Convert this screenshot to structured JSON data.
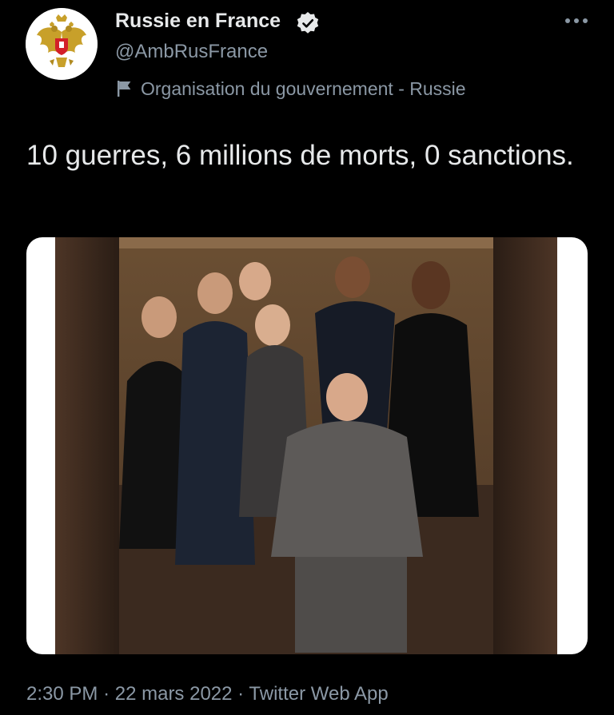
{
  "account": {
    "display_name": "Russie en France",
    "handle": "@AmbRusFrance",
    "org_label": "Organisation du gouvernement - Russie",
    "avatar_icon": "russian-coat-of-arms-icon",
    "verified_icon": "verified-badge-icon"
  },
  "tweet": {
    "text": "10 guerres, 6 millions de morts, 0 sanctions."
  },
  "meta": {
    "time": "2:30 PM",
    "date": "22 mars 2022",
    "client": "Twitter Web App",
    "separator": "·"
  },
  "colors": {
    "background": "#000000",
    "text": "#e7e9ea",
    "secondary": "#8b98a5",
    "media_frame": "#ffffff"
  }
}
